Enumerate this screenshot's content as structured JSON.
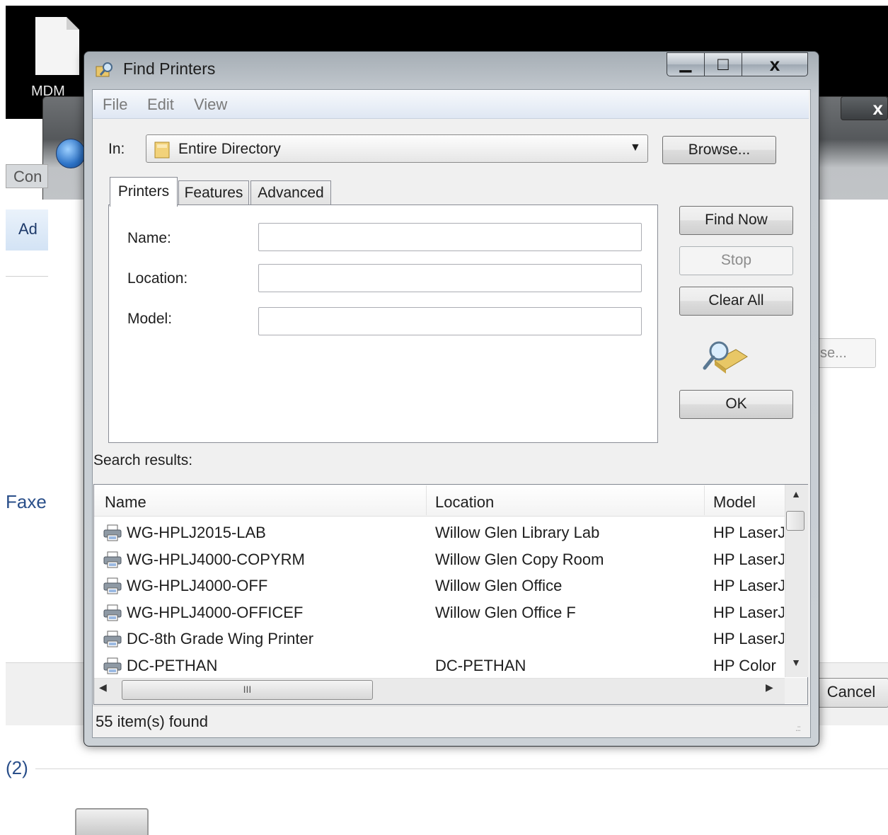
{
  "desktop": {
    "file_label": "MDM"
  },
  "background_window": {
    "tab_fragment": "Con",
    "action_fragment": "Ad",
    "section_fragment": "Faxe",
    "count_fragment": "(2)",
    "cancel_label": "Cancel",
    "browse_fragment": "se...",
    "close_glyph": "x"
  },
  "dialog": {
    "title": "Find Printers",
    "title_icon": "find-printers-icon",
    "window_buttons": {
      "minimize": "▁",
      "maximize": "□",
      "close": "x"
    },
    "menu": [
      "File",
      "Edit",
      "View"
    ],
    "in_label": "In:",
    "in_value": "Entire Directory",
    "browse_label": "Browse...",
    "tabs": [
      "Printers",
      "Features",
      "Advanced"
    ],
    "fields": [
      {
        "label": "Name:",
        "value": "",
        "placeholder": ""
      },
      {
        "label": "Location:",
        "value": "",
        "placeholder": ""
      },
      {
        "label": "Model:",
        "value": "",
        "placeholder": ""
      }
    ],
    "buttons": {
      "find_now": "Find Now",
      "stop": "Stop",
      "clear_all": "Clear All",
      "ok": "OK"
    },
    "results_label": "Search results:",
    "columns": [
      "Name",
      "Location",
      "Model"
    ],
    "rows": [
      {
        "name": "WG-HPLJ2015-LAB",
        "location": "Willow Glen Library Lab",
        "model": "HP LaserJ"
      },
      {
        "name": "WG-HPLJ4000-COPYRM",
        "location": "Willow Glen Copy Room",
        "model": "HP LaserJ"
      },
      {
        "name": "WG-HPLJ4000-OFF",
        "location": "Willow Glen Office",
        "model": "HP LaserJ"
      },
      {
        "name": "WG-HPLJ4000-OFFICEF",
        "location": "Willow Glen Office F",
        "model": "HP LaserJ"
      },
      {
        "name": "DC-8th Grade Wing Printer",
        "location": "",
        "model": "HP LaserJ"
      },
      {
        "name": "DC-PETHAN",
        "location": "DC-PETHAN",
        "model": "HP Color"
      }
    ],
    "scroll": {
      "up": "▲",
      "down": "▼",
      "left": "◀",
      "right": "▶",
      "grip": "III"
    },
    "status": "55 item(s) found",
    "resize_grip": ".::"
  }
}
